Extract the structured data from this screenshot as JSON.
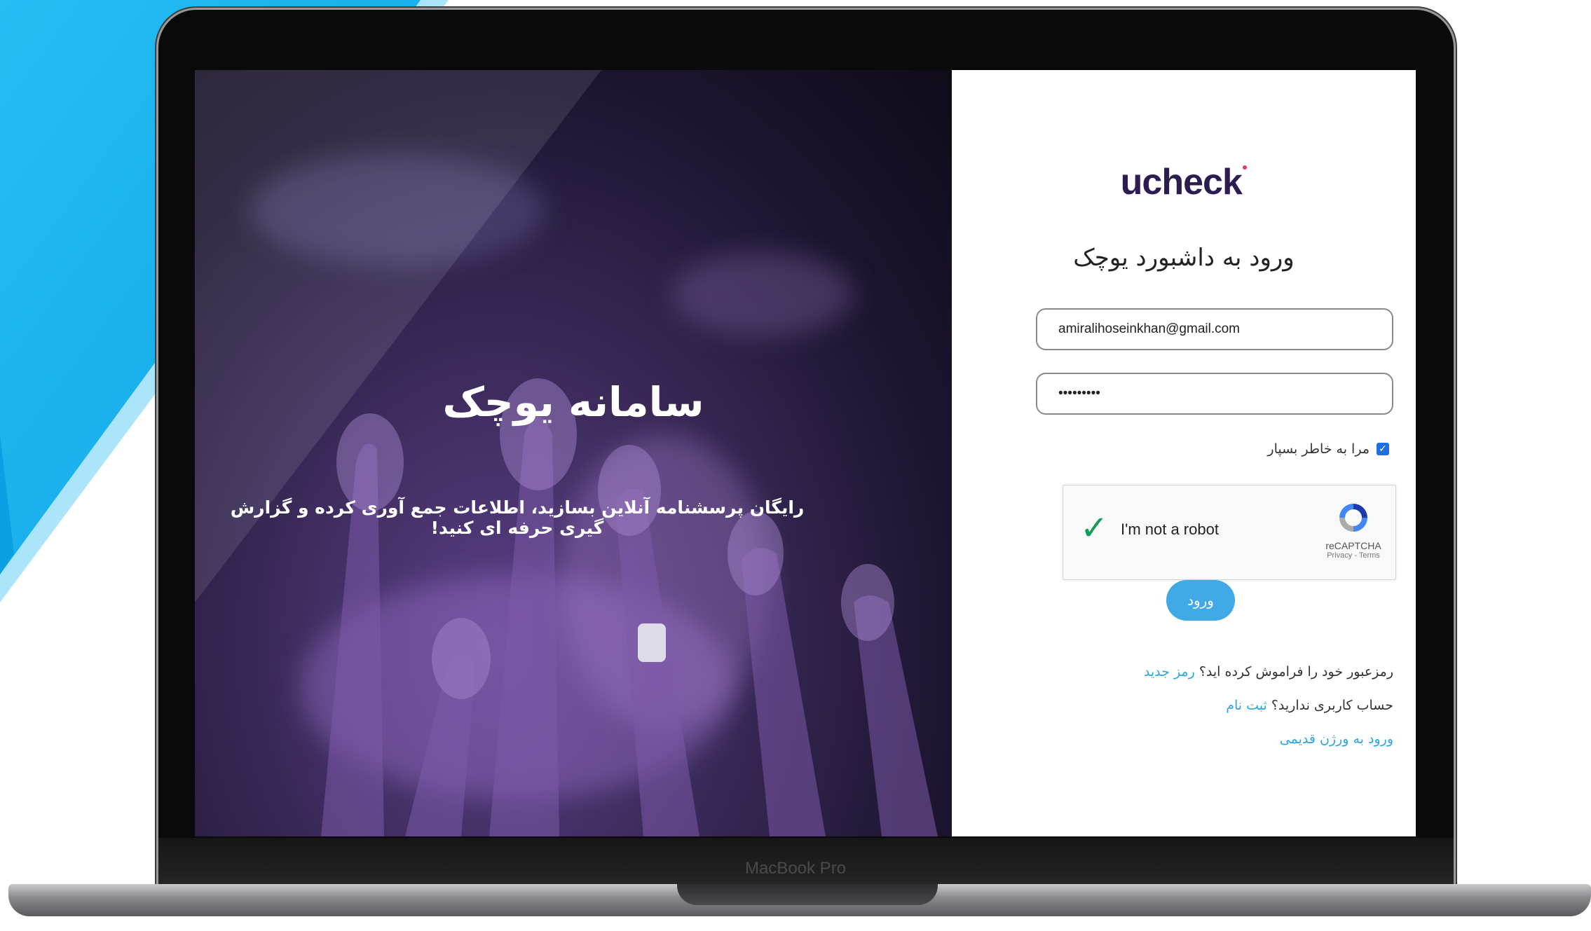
{
  "device": {
    "label": "MacBook Pro"
  },
  "hero": {
    "title": "سامانه یوچک",
    "subtitle": "رایگان پرسشنامه آنلاین بسازید، اطلاعات جمع آوری کرده و گزارش گیری حرفه ای کنید!"
  },
  "login": {
    "logo_text": "ucheck",
    "title": "ورود به داشبورد یوچک",
    "email_value": "amiralihoseinkhan@gmail.com",
    "password_value": "•••••••••",
    "remember_label": "مرا به خاطر بسپار",
    "remember_checked": true,
    "captcha": {
      "label": "I'm not a robot",
      "brand": "reCAPTCHA",
      "links": "Privacy - Terms"
    },
    "submit_label": "ورود",
    "forgot_text": "رمزعبور خود را فراموش کرده اید؟",
    "forgot_link": "رمز جدید",
    "no_account_text": "حساب کاربری ندارید؟",
    "register_link": "ثبت نام",
    "old_version_link": "ورود به ورژن قدیمی"
  },
  "colors": {
    "brand_dark": "#2c1c52",
    "accent_blue": "#41a9e6",
    "link_blue": "#2aa6e3",
    "background_blue": "#1fb4ef"
  }
}
